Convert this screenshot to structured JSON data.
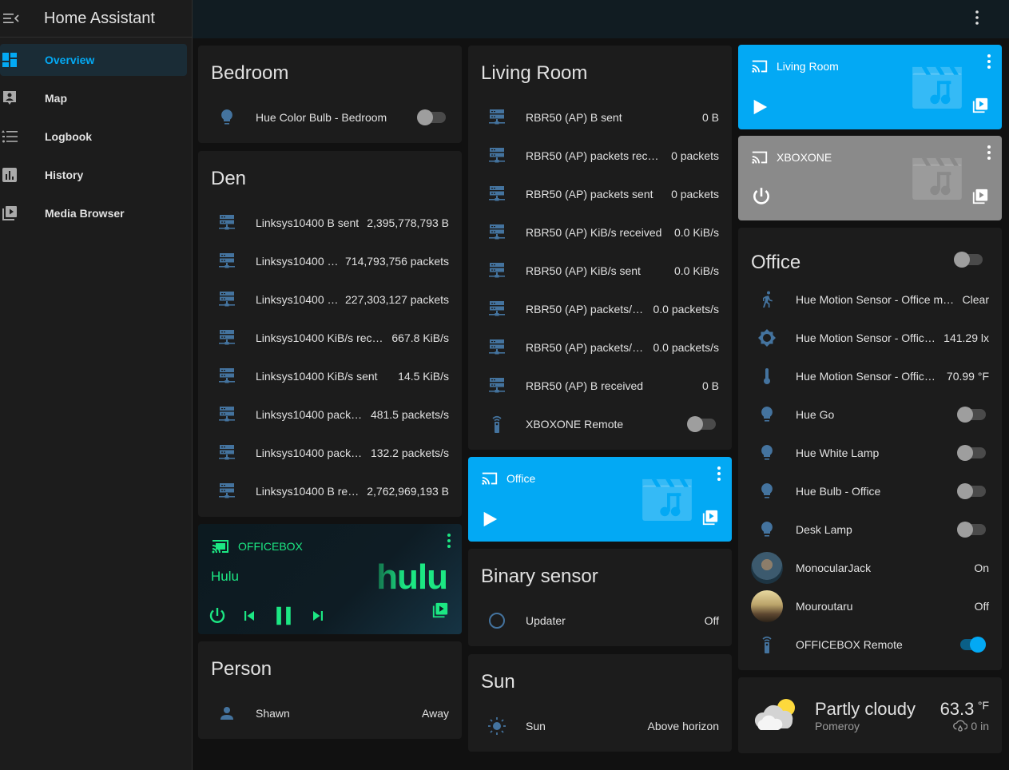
{
  "app": {
    "title": "Home Assistant"
  },
  "sidebar": {
    "items": [
      {
        "label": "Overview",
        "icon": "view-dashboard-icon",
        "active": true
      },
      {
        "label": "Map",
        "icon": "map-account-icon"
      },
      {
        "label": "Logbook",
        "icon": "format-list-bulleted-icon"
      },
      {
        "label": "History",
        "icon": "chart-box-icon"
      },
      {
        "label": "Media Browser",
        "icon": "play-box-multiple-icon"
      }
    ]
  },
  "colors": {
    "accent": "#03a9f4",
    "entity_icon": "#44739e",
    "hulu_green": "#1ce783",
    "media_idle": "#8a8a8a"
  },
  "bedroom": {
    "title": "Bedroom",
    "rows": [
      {
        "name": "Hue Color Bulb - Bedroom",
        "icon": "lightbulb-icon",
        "toggle": false
      }
    ]
  },
  "den": {
    "title": "Den",
    "rows": [
      {
        "name": "Linksys10400 B sent",
        "state": "2,395,778,793 B"
      },
      {
        "name": "Linksys10400 …",
        "state": "714,793,756 packets"
      },
      {
        "name": "Linksys10400 …",
        "state": "227,303,127 packets"
      },
      {
        "name": "Linksys10400 KiB/s rec…",
        "state": "667.8 KiB/s"
      },
      {
        "name": "Linksys10400 KiB/s sent",
        "state": "14.5 KiB/s"
      },
      {
        "name": "Linksys10400 pack…",
        "state": "481.5 packets/s"
      },
      {
        "name": "Linksys10400 pack…",
        "state": "132.2 packets/s"
      },
      {
        "name": "Linksys10400 B rec…",
        "state": "2,762,969,193 B"
      }
    ]
  },
  "officebox_player": {
    "name": "OFFICEBOX",
    "app": "Hulu",
    "logo": "hulu"
  },
  "person": {
    "title": "Person",
    "rows": [
      {
        "name": "Shawn",
        "state": "Away"
      }
    ]
  },
  "living_room": {
    "title": "Living Room",
    "rows": [
      {
        "name": "RBR50 (AP) B sent",
        "state": "0 B"
      },
      {
        "name": "RBR50 (AP) packets recei…",
        "state": "0 packets"
      },
      {
        "name": "RBR50 (AP) packets sent",
        "state": "0 packets"
      },
      {
        "name": "RBR50 (AP) KiB/s received",
        "state": "0.0 KiB/s"
      },
      {
        "name": "RBR50 (AP) KiB/s sent",
        "state": "0.0 KiB/s"
      },
      {
        "name": "RBR50 (AP) packets/s…",
        "state": "0.0 packets/s"
      },
      {
        "name": "RBR50 (AP) packets/s…",
        "state": "0.0 packets/s"
      },
      {
        "name": "RBR50 (AP) B received",
        "state": "0 B"
      }
    ],
    "remote": {
      "name": "XBOXONE Remote",
      "toggle": false
    }
  },
  "office_player": {
    "name": "Office"
  },
  "binary_sensor": {
    "title": "Binary sensor",
    "rows": [
      {
        "name": "Updater",
        "state": "Off"
      }
    ]
  },
  "sun": {
    "title": "Sun",
    "rows": [
      {
        "name": "Sun",
        "state": "Above horizon"
      }
    ]
  },
  "living_room_player": {
    "name": "Living Room"
  },
  "xboxone_player": {
    "name": "XBOXONE"
  },
  "office": {
    "title": "Office",
    "header_toggle": false,
    "sensors": [
      {
        "name": "Hue Motion Sensor - Office mo…",
        "state": "Clear",
        "icon": "walk-icon"
      },
      {
        "name": "Hue Motion Sensor - Office…",
        "state": "141.29 lx",
        "icon": "brightness-icon"
      },
      {
        "name": "Hue Motion Sensor - Office …",
        "state": "70.99 °F",
        "icon": "thermometer-icon"
      }
    ],
    "lights": [
      {
        "name": "Hue Go",
        "toggle": false
      },
      {
        "name": "Hue White Lamp",
        "toggle": false
      },
      {
        "name": "Hue Bulb - Office",
        "toggle": false
      },
      {
        "name": "Desk Lamp",
        "toggle": false
      }
    ],
    "people": [
      {
        "name": "MonocularJack",
        "state": "On"
      },
      {
        "name": "Mouroutaru",
        "state": "Off"
      }
    ],
    "remote": {
      "name": "OFFICEBOX Remote",
      "toggle": true
    }
  },
  "weather": {
    "condition": "Partly cloudy",
    "location": "Pomeroy",
    "temperature": "63.3",
    "unit": "°F",
    "precipitation": "0 in"
  }
}
